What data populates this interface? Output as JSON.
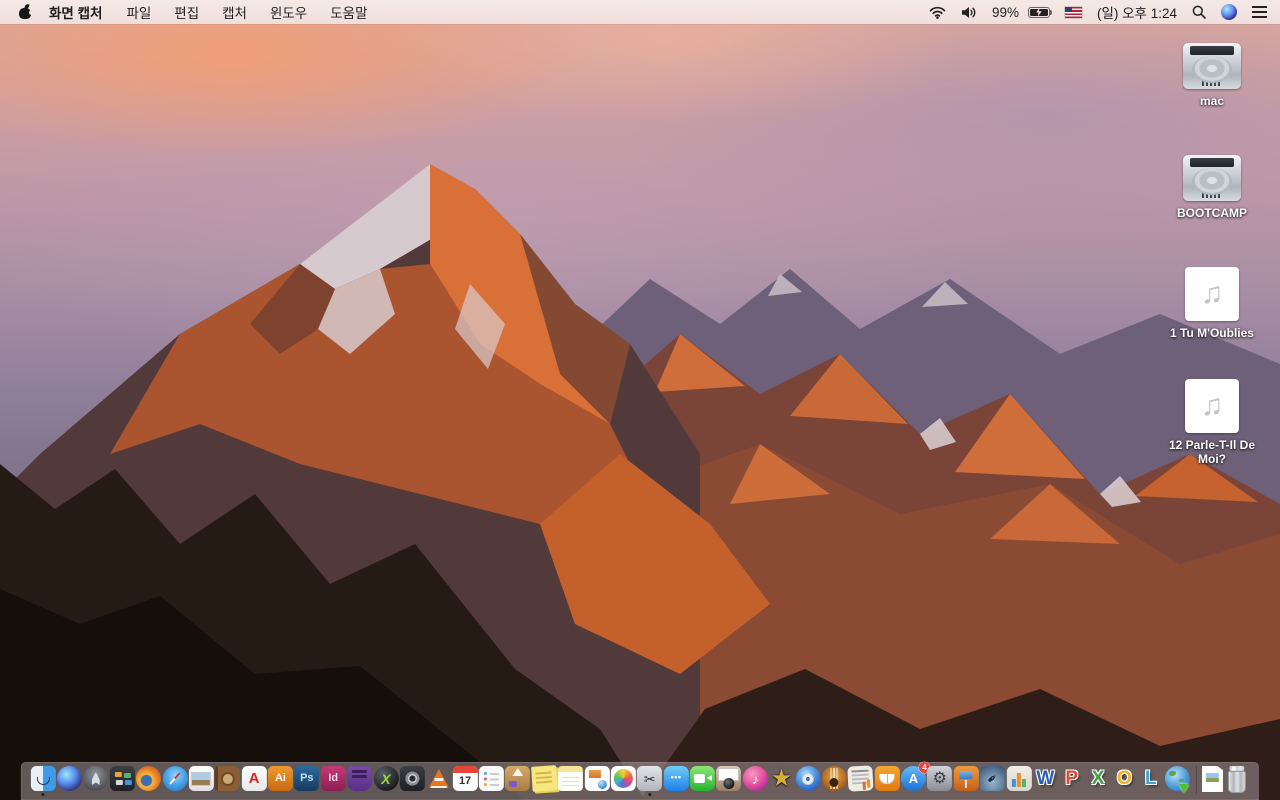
{
  "menu_bar": {
    "app_name": "화면 캡처",
    "menus": [
      "파일",
      "편집",
      "캡처",
      "윈도우",
      "도움말"
    ],
    "status": {
      "battery_percent": "99%",
      "clock": "(일) 오후 1:24"
    }
  },
  "desktop": {
    "icons": [
      {
        "name": "mac",
        "kind": "drive",
        "label": "mac"
      },
      {
        "name": "bootcamp",
        "kind": "drive",
        "label": "BOOTCAMP"
      },
      {
        "name": "tu-moublies",
        "kind": "audio",
        "glyph": "♫",
        "label": "1 Tu M'Oublies"
      },
      {
        "name": "parle-t-il-de-moi",
        "kind": "audio",
        "glyph": "♫",
        "label": "12 Parle-T-Il De Moi?"
      }
    ]
  },
  "dock": {
    "items": [
      {
        "name": "finder",
        "running": true
      },
      {
        "name": "siri"
      },
      {
        "name": "launchpad"
      },
      {
        "name": "mission-control"
      },
      {
        "name": "firefox"
      },
      {
        "name": "safari"
      },
      {
        "name": "preview"
      },
      {
        "name": "contacts"
      },
      {
        "name": "acrobat-reader",
        "glyph": "A"
      },
      {
        "name": "illustrator",
        "glyph": "Ai"
      },
      {
        "name": "photoshop",
        "glyph": "Ps"
      },
      {
        "name": "indesign",
        "glyph": "Id"
      },
      {
        "name": "toast"
      },
      {
        "name": "x-app",
        "glyph": "X"
      },
      {
        "name": "disk-utility"
      },
      {
        "name": "vlc"
      },
      {
        "name": "calendar",
        "glyph": "17"
      },
      {
        "name": "reminders"
      },
      {
        "name": "stuffit-expander"
      },
      {
        "name": "stickies"
      },
      {
        "name": "notes"
      },
      {
        "name": "iweb"
      },
      {
        "name": "photos"
      },
      {
        "name": "grab",
        "glyph": "✂",
        "running": true
      },
      {
        "name": "messages",
        "glyph": "•••"
      },
      {
        "name": "facetime"
      },
      {
        "name": "photo-booth"
      },
      {
        "name": "itunes",
        "glyph": "♪"
      },
      {
        "name": "imovie",
        "glyph": "★"
      },
      {
        "name": "dvd-player"
      },
      {
        "name": "garageband"
      },
      {
        "name": "newspaper-app"
      },
      {
        "name": "ibooks"
      },
      {
        "name": "app-store",
        "glyph": "A",
        "badge": "4"
      },
      {
        "name": "system-preferences",
        "glyph": "⚙"
      },
      {
        "name": "keynote"
      },
      {
        "name": "pages",
        "glyph": "✒"
      },
      {
        "name": "numbers"
      },
      {
        "name": "word",
        "glyph": "W"
      },
      {
        "name": "powerpoint",
        "glyph": "P"
      },
      {
        "name": "excel",
        "glyph": "X"
      },
      {
        "name": "outlook",
        "glyph": "O"
      },
      {
        "name": "lync",
        "glyph": "L"
      },
      {
        "name": "internet-download"
      },
      {
        "divider": true
      },
      {
        "name": "jpeg-file"
      },
      {
        "name": "trash"
      }
    ]
  }
}
